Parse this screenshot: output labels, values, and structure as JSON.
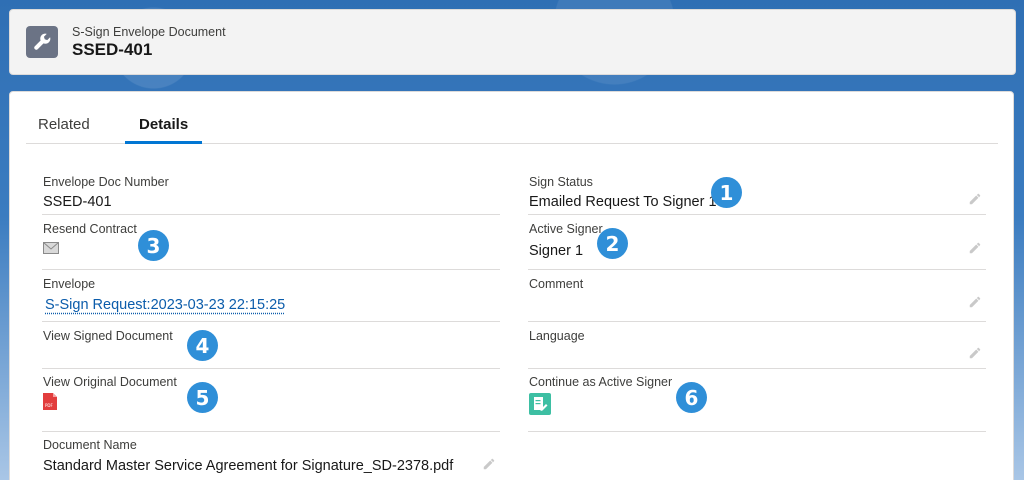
{
  "header": {
    "subtitle": "S-Sign Envelope Document",
    "title": "SSED-401",
    "icon": "wrench-icon",
    "icon_bg": "#6b7385"
  },
  "tabs": [
    {
      "label": "Related",
      "active": false
    },
    {
      "label": "Details",
      "active": true
    }
  ],
  "left_fields": {
    "envelope_doc_number": {
      "label": "Envelope Doc Number",
      "value": "SSED-401"
    },
    "resend_contract": {
      "label": "Resend Contract",
      "icon": "envelope-icon"
    },
    "envelope": {
      "label": "Envelope",
      "value": "S-Sign Request:2023-03-23 22:15:25"
    },
    "view_signed_document": {
      "label": "View Signed Document"
    },
    "view_original_document": {
      "label": "View Original Document",
      "icon": "pdf-icon"
    },
    "document_name": {
      "label": "Document Name",
      "value": "Standard Master Service Agreement for Signature_SD-2378.pdf"
    }
  },
  "right_fields": {
    "sign_status": {
      "label": "Sign Status",
      "value": "Emailed Request To Signer 1"
    },
    "active_signer": {
      "label": "Active Signer",
      "value": "Signer 1"
    },
    "comment": {
      "label": "Comment",
      "value": ""
    },
    "language": {
      "label": "Language",
      "value": ""
    },
    "continue_active_signer": {
      "label": "Continue as Active Signer",
      "icon": "sign-document-icon"
    }
  },
  "badges": [
    "1",
    "2",
    "3",
    "4",
    "5",
    "6"
  ],
  "colors": {
    "accent": "#0176d3",
    "link": "#0b5cab",
    "badge": "#2f8fd8",
    "pdf_red": "#e23d3d",
    "sign_icon_bg": "#3dbfa3"
  }
}
